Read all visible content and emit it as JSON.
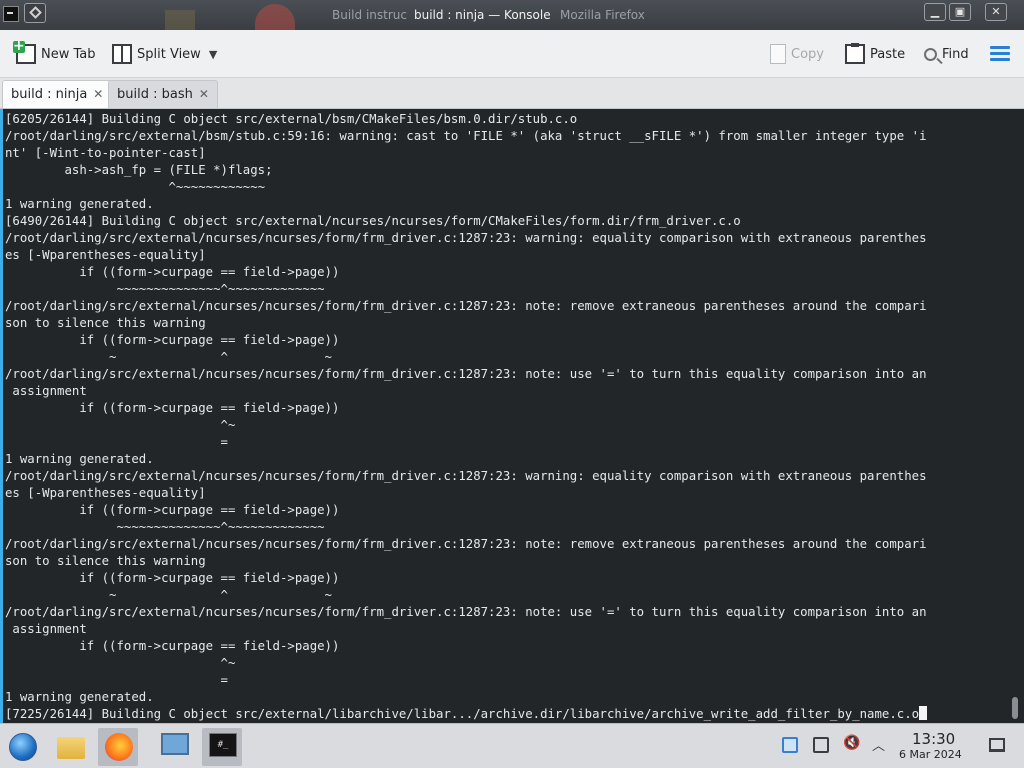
{
  "window": {
    "title": "build : ninja — Konsole",
    "ghost_title_left": "Build instruc",
    "ghost_title_right": "Mozilla Firefox",
    "buttons": {
      "minimize": "▁",
      "maximize": "▣",
      "close": "✕"
    }
  },
  "toolbar": {
    "new_tab": "New Tab",
    "split_view": "Split View",
    "copy": "Copy",
    "paste": "Paste",
    "find": "Find"
  },
  "tabs": [
    {
      "label": "build : ninja",
      "active": true
    },
    {
      "label": "build : bash",
      "active": false
    }
  ],
  "terminal": {
    "lines": [
      "[6205/26144] Building C object src/external/bsm/CMakeFiles/bsm.0.dir/stub.c.o",
      "/root/darling/src/external/bsm/stub.c:59:16: warning: cast to 'FILE *' (aka 'struct __sFILE *') from smaller integer type 'i",
      "nt' [-Wint-to-pointer-cast]",
      "        ash->ash_fp = (FILE *)flags;",
      "                      ^~~~~~~~~~~~~",
      "1 warning generated.",
      "[6490/26144] Building C object src/external/ncurses/ncurses/form/CMakeFiles/form.dir/frm_driver.c.o",
      "/root/darling/src/external/ncurses/ncurses/form/frm_driver.c:1287:23: warning: equality comparison with extraneous parenthes",
      "es [-Wparentheses-equality]",
      "          if ((form->curpage == field->page))",
      "               ~~~~~~~~~~~~~~^~~~~~~~~~~~~~",
      "/root/darling/src/external/ncurses/ncurses/form/frm_driver.c:1287:23: note: remove extraneous parentheses around the compari",
      "son to silence this warning",
      "          if ((form->curpage == field->page))",
      "              ~              ^             ~",
      "/root/darling/src/external/ncurses/ncurses/form/frm_driver.c:1287:23: note: use '=' to turn this equality comparison into an",
      " assignment",
      "          if ((form->curpage == field->page))",
      "                             ^~",
      "                             =",
      "1 warning generated.",
      "/root/darling/src/external/ncurses/ncurses/form/frm_driver.c:1287:23: warning: equality comparison with extraneous parenthes",
      "es [-Wparentheses-equality]",
      "          if ((form->curpage == field->page))",
      "               ~~~~~~~~~~~~~~^~~~~~~~~~~~~~",
      "/root/darling/src/external/ncurses/ncurses/form/frm_driver.c:1287:23: note: remove extraneous parentheses around the compari",
      "son to silence this warning",
      "          if ((form->curpage == field->page))",
      "              ~              ^             ~",
      "/root/darling/src/external/ncurses/ncurses/form/frm_driver.c:1287:23: note: use '=' to turn this equality comparison into an",
      " assignment",
      "          if ((form->curpage == field->page))",
      "                             ^~",
      "                             =",
      "1 warning generated."
    ],
    "last_line": "[7225/26144] Building C object src/external/libarchive/libar.../archive.dir/libarchive/archive_write_add_filter_by_name.c.o"
  },
  "taskbar": {
    "apps": [
      "start-menu",
      "file-manager",
      "firefox",
      "system-settings",
      "konsole"
    ],
    "terminal_glyph": "#_",
    "clock_time": "13:30",
    "clock_date": "6 Mar 2024"
  },
  "colors": {
    "terminal_bg": "#232629",
    "terminal_fg": "#e6e8ea",
    "accent": "#3daee9"
  }
}
